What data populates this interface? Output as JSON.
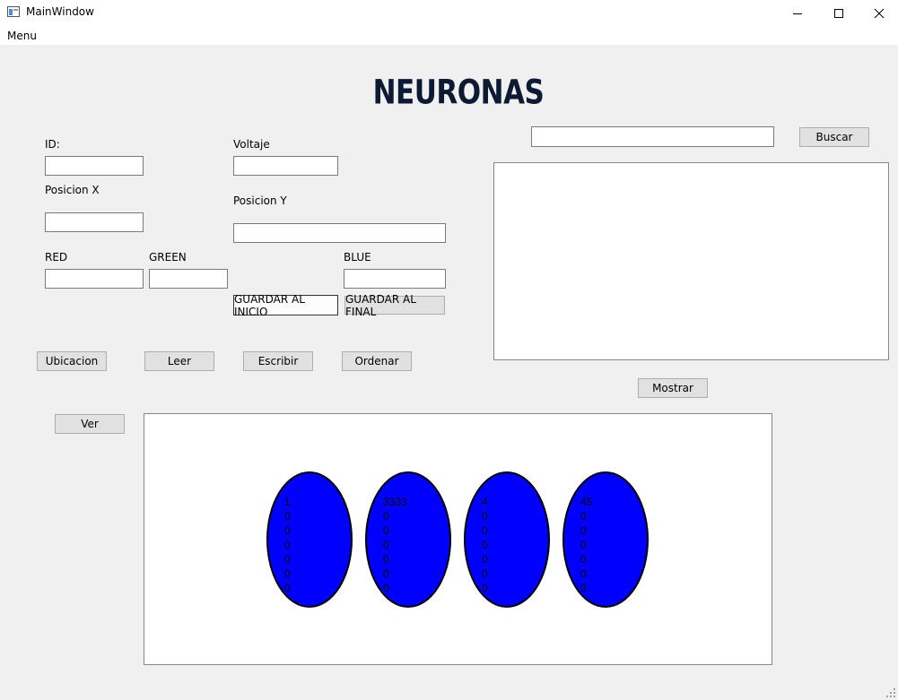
{
  "window": {
    "title": "MainWindow"
  },
  "menu": {
    "label": "Menu"
  },
  "heading": "NEURONAS",
  "form": {
    "id_label": "ID:",
    "voltaje_label": "Voltaje",
    "posx_label": "Posicion X",
    "posy_label": "Posicion Y",
    "red_label": "RED",
    "green_label": "GREEN",
    "blue_label": "BLUE",
    "id_value": "",
    "voltaje_value": "",
    "posx_value": "",
    "posy_value": "",
    "red_value": "",
    "green_value": "",
    "blue_value": ""
  },
  "buttons": {
    "guardar_inicio": "GUARDAR AL INICIO",
    "guardar_final": "GUARDAR AL FINAL",
    "ubicacion": "Ubicacion",
    "leer": "Leer",
    "escribir": "Escribir",
    "ordenar": "Ordenar",
    "ver": "Ver",
    "buscar": "Buscar",
    "mostrar": "Mostrar"
  },
  "search": {
    "value": ""
  },
  "colors": {
    "neuron_fill": "#0000ff",
    "neuron_stroke": "#000000"
  },
  "neurons": [
    {
      "lines": [
        "1",
        "0",
        "0",
        "0",
        "0",
        "0",
        "0"
      ]
    },
    {
      "lines": [
        "3333",
        "0",
        "0",
        "0",
        "0",
        "0",
        "0"
      ]
    },
    {
      "lines": [
        "4",
        "0",
        "0",
        "0",
        "0",
        "0",
        "0"
      ]
    },
    {
      "lines": [
        "45",
        "0",
        "0",
        "0",
        "0",
        "0",
        "0"
      ]
    }
  ]
}
